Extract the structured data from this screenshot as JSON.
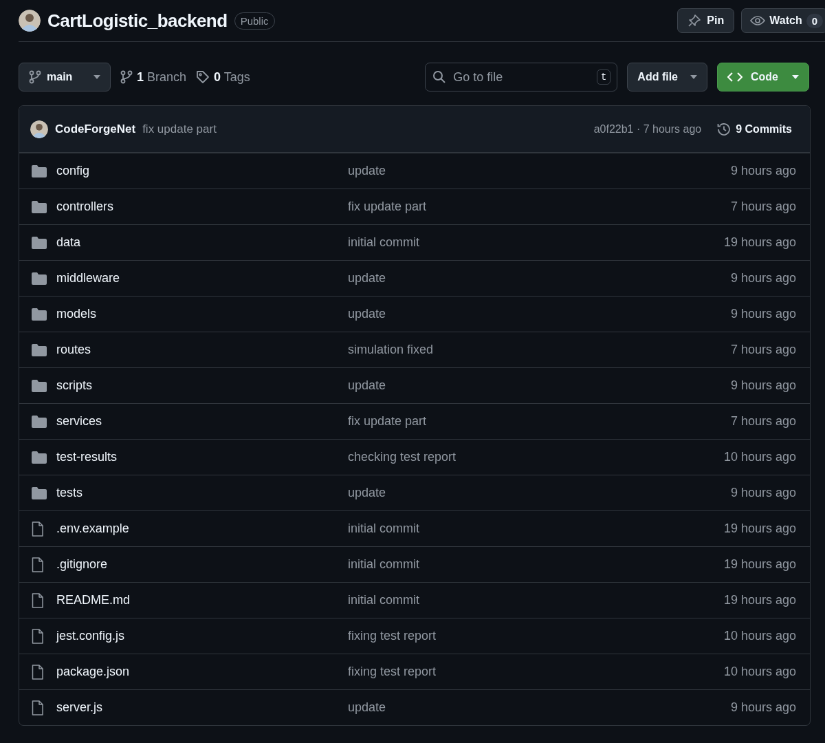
{
  "repo": {
    "name": "CartLogistic_backend",
    "visibility": "Public"
  },
  "actions": {
    "pin": "Pin",
    "watch": "Watch",
    "watch_count": "0"
  },
  "toolbar": {
    "branch": "main",
    "branches": "**1** Branch",
    "tags": "**0** Tags",
    "search": {
      "placeholder": "Go to file",
      "shortcut": "t"
    },
    "add_file": "Add file",
    "code": "Code"
  },
  "latest_commit": {
    "author": "CodeForgeNet",
    "message": "fix update part",
    "hash_time": "a0f22b1 · 7 hours ago",
    "commits": "9 Commits"
  },
  "files": [
    {
      "kind": "folder",
      "name": "config",
      "message": "update",
      "time": "9 hours ago"
    },
    {
      "kind": "folder",
      "name": "controllers",
      "message": "fix update part",
      "time": "7 hours ago"
    },
    {
      "kind": "folder",
      "name": "data",
      "message": "initial commit",
      "time": "19 hours ago"
    },
    {
      "kind": "folder",
      "name": "middleware",
      "message": "update",
      "time": "9 hours ago"
    },
    {
      "kind": "folder",
      "name": "models",
      "message": "update",
      "time": "9 hours ago"
    },
    {
      "kind": "folder",
      "name": "routes",
      "message": "simulation fixed",
      "time": "7 hours ago"
    },
    {
      "kind": "folder",
      "name": "scripts",
      "message": "update",
      "time": "9 hours ago"
    },
    {
      "kind": "folder",
      "name": "services",
      "message": "fix update part",
      "time": "7 hours ago"
    },
    {
      "kind": "folder",
      "name": "test-results",
      "message": "checking test report",
      "time": "10 hours ago"
    },
    {
      "kind": "folder",
      "name": "tests",
      "message": "update",
      "time": "9 hours ago"
    },
    {
      "kind": "file",
      "name": ".env.example",
      "message": "initial commit",
      "time": "19 hours ago"
    },
    {
      "kind": "file",
      "name": ".gitignore",
      "message": "initial commit",
      "time": "19 hours ago"
    },
    {
      "kind": "file",
      "name": "README.md",
      "message": "initial commit",
      "time": "19 hours ago"
    },
    {
      "kind": "file",
      "name": "jest.config.js",
      "message": "fixing test report",
      "time": "10 hours ago"
    },
    {
      "kind": "file",
      "name": "package.json",
      "message": "fixing test report",
      "time": "10 hours ago"
    },
    {
      "kind": "file",
      "name": "server.js",
      "message": "update",
      "time": "9 hours ago"
    }
  ]
}
